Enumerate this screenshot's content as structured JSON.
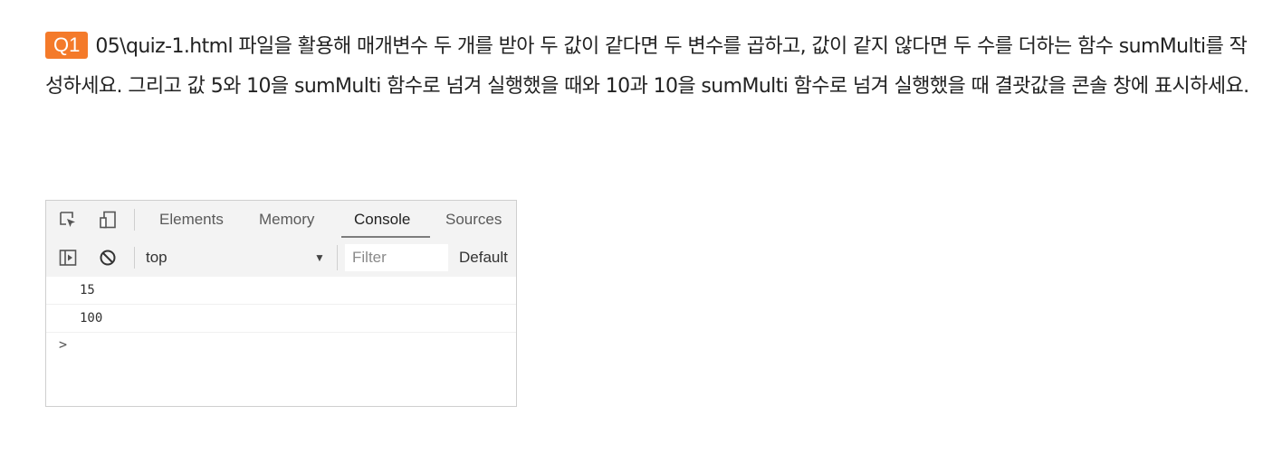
{
  "question": {
    "badge": "Q1",
    "text": "05\\quiz-1.html 파일을 활용해 매개변수 두 개를 받아 두 값이 같다면 두 변수를 곱하고, 값이 같지 않다면 두 수를 더하는 함수 sumMulti를 작성하세요. 그리고 값 5와 10을 sumMulti 함수로 넘겨 실행했을 때와 10과 10을 sumMulti 함수로 넘겨 실행했을 때 결괏값을 콘솔 창에 표시하세요."
  },
  "devtools": {
    "icons": [
      "inspect-element-icon",
      "device-toolbar-icon",
      "sidebar-toggle-icon",
      "clear-console-icon"
    ],
    "tabs": [
      {
        "label": "Elements",
        "active": false
      },
      {
        "label": "Memory",
        "active": false
      },
      {
        "label": "Console",
        "active": true
      },
      {
        "label": "Sources",
        "active": false
      }
    ],
    "context": "top",
    "filter_placeholder": "Filter",
    "levels": "Default",
    "console_output": [
      "15",
      "100"
    ],
    "prompt": ">"
  },
  "colors": {
    "badge": "#f47a2a",
    "toolbar_bg": "#f3f3f3",
    "border": "#cfcfcf"
  }
}
